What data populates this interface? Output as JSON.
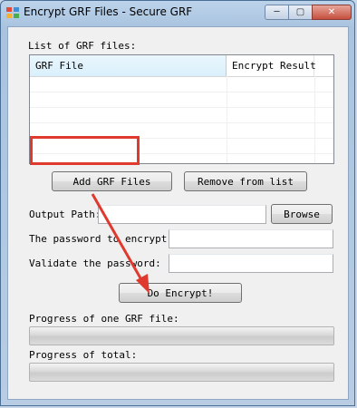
{
  "window": {
    "title": "Encrypt GRF Files - Secure GRF",
    "min_glyph": "─",
    "max_glyph": "▢",
    "close_glyph": "✕"
  },
  "file_list": {
    "label": "List of GRF files:",
    "columns": [
      "GRF File",
      "Encrypt Result",
      ""
    ]
  },
  "buttons": {
    "add": "Add GRF Files",
    "remove": "Remove from list",
    "browse": "Browse",
    "encrypt": "Do Encrypt!"
  },
  "output": {
    "label": "Output Path:",
    "value": ""
  },
  "password": {
    "label": "The password to encrypt:",
    "value": ""
  },
  "validate": {
    "label": "Validate the password:",
    "value": ""
  },
  "progress": {
    "one_label": "Progress of one GRF file:",
    "one_value": 0,
    "total_label": "Progress of total:",
    "total_value": 0
  },
  "colors": {
    "annotation": "#e03a2f",
    "progress_fill": "#37b44a"
  }
}
